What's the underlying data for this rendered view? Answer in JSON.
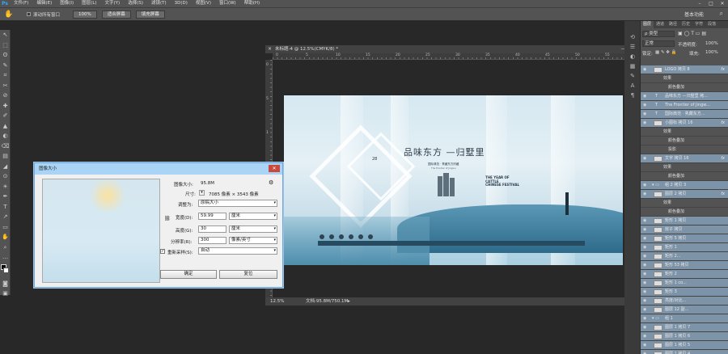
{
  "app": {
    "logo": "Ps"
  },
  "menu": [
    "文件(F)",
    "编辑(E)",
    "图像(I)",
    "图层(L)",
    "文字(Y)",
    "选择(S)",
    "滤镜(T)",
    "3D(D)",
    "视图(V)",
    "窗口(W)",
    "帮助(H)"
  ],
  "window_controls": {
    "min": "–",
    "max": "□",
    "close": "✕"
  },
  "options": {
    "scroll_all_label": "滚动所有窗口",
    "zoom_100": "100%",
    "fit_screen": "适合屏幕",
    "fill_screen": "填充屏幕",
    "workspace": "基本功能"
  },
  "document": {
    "tab_title": "未标题-4 @ 12.5%(CMYK/8) *",
    "zoom": "12.5%",
    "doc_size": "文档:95.8M/750.1M",
    "ruler_h": [
      "0",
      "5",
      "10",
      "15",
      "20",
      "25",
      "30",
      "35",
      "40",
      "45",
      "50",
      "55",
      "60"
    ],
    "ruler_v": [
      "0",
      "5",
      "1",
      "1",
      "2",
      "2",
      "3"
    ]
  },
  "artwork": {
    "headline": "品味东方  —归墅里",
    "subline": "国际典范 · 隽藏东方府藏",
    "subline2": "The Frontier of Jingwu",
    "badge": "28",
    "year_text": [
      "THE YEAR OF",
      "CATTLE",
      "CHINESE FESTIVAL"
    ]
  },
  "dialog": {
    "title": "图像大小",
    "close": "✕",
    "image_size_label": "图像大小:",
    "image_size_value": "95.8M",
    "dims_label": "尺寸:",
    "dims_value": "7085 像素 × 3543 像素",
    "fit_label": "调整为:",
    "fit_value": "原稿大小",
    "width_label": "宽度(D):",
    "width_value": "59.99",
    "width_unit": "厘米",
    "height_label": "高度(G):",
    "height_value": "30",
    "height_unit": "厘米",
    "res_label": "分辨率(R):",
    "res_value": "300",
    "res_unit": "像素/英寸",
    "resample_label": "重新采样(S):",
    "resample_value": "自动",
    "resample_checked": "✓",
    "ok": "确定",
    "reset": "复位"
  },
  "panel": {
    "tabs": [
      "图层",
      "通道",
      "路径",
      "历史",
      "字符",
      "段落"
    ],
    "kind_filter": "ρ 类型",
    "blend_mode": "正常",
    "opacity_label": "不透明度:",
    "opacity_value": "100%",
    "lock_label": "锁定:",
    "fill_label": "填充:",
    "fill_value": "100%",
    "layers": [
      {
        "name": "LOGO 拷贝 8",
        "fx": "fx",
        "sel": true
      },
      {
        "name": "效果",
        "fx": "",
        "sel": false,
        "sub": 1
      },
      {
        "name": "颜色叠加",
        "fx": "",
        "sel": false,
        "sub": 2
      },
      {
        "name": "品味东方 —归墅里 拷...",
        "fx": "",
        "sel": true,
        "type": "T"
      },
      {
        "name": "The Frontier of Jingw...",
        "fx": "",
        "sel": true,
        "type": "T"
      },
      {
        "name": "国际典范 · 隽藏东方...",
        "fx": "",
        "sel": true,
        "type": "T"
      },
      {
        "name": "小图标 拷贝 16",
        "fx": "fx",
        "sel": true
      },
      {
        "name": "效果",
        "fx": "",
        "sel": false,
        "sub": 1
      },
      {
        "name": "颜色叠加",
        "fx": "",
        "sel": false,
        "sub": 2
      },
      {
        "name": "投影",
        "fx": "",
        "sel": false,
        "sub": 2
      },
      {
        "name": "文字 拷贝 16",
        "fx": "fx",
        "sel": true
      },
      {
        "name": "效果",
        "fx": "",
        "sel": false,
        "sub": 1
      },
      {
        "name": "颜色叠加",
        "fx": "",
        "sel": false,
        "sub": 2
      },
      {
        "name": "组 2 拷贝 3",
        "fx": "",
        "sel": true,
        "group": true
      },
      {
        "name": "图层 2 拷贝",
        "fx": "fx",
        "sel": true
      },
      {
        "name": "效果",
        "fx": "",
        "sel": false,
        "sub": 1
      },
      {
        "name": "颜色叠加",
        "fx": "",
        "sel": false,
        "sub": 2
      },
      {
        "name": "矩形 1 拷贝",
        "fx": "",
        "sel": true
      },
      {
        "name": "房子 拷贝",
        "fx": "",
        "sel": true
      },
      {
        "name": "矩形 5 拷贝",
        "fx": "",
        "sel": true
      },
      {
        "name": "矩形 1",
        "fx": "",
        "sel": true
      },
      {
        "name": "矩形 2...",
        "fx": "",
        "sel": true
      },
      {
        "name": "矩形 53 拷贝",
        "fx": "",
        "sel": true
      },
      {
        "name": "矩形 2",
        "fx": "",
        "sel": true
      },
      {
        "name": "矩形 1 co...",
        "fx": "",
        "sel": true
      },
      {
        "name": "矩形 3",
        "fx": "",
        "sel": true
      },
      {
        "name": "亮度/对比...",
        "fx": "",
        "sel": true
      },
      {
        "name": "图层 12 副...",
        "fx": "",
        "sel": true
      },
      {
        "name": "组 1",
        "fx": "",
        "sel": true,
        "group": true
      },
      {
        "name": "图层 1 拷贝 7",
        "fx": "",
        "sel": true
      },
      {
        "name": "图层 1 拷贝 6",
        "fx": "",
        "sel": true
      },
      {
        "name": "图层 1 拷贝 5",
        "fx": "",
        "sel": true
      },
      {
        "name": "图层 1 拷贝 4",
        "fx": "",
        "sel": true
      }
    ]
  },
  "tools": [
    "↖",
    "⬚",
    "ʘ",
    "✎",
    "⌗",
    "✂",
    "⊘",
    "✚",
    "✐",
    "▲",
    "◐",
    "⌫",
    "▤",
    "◢",
    "⊙",
    "☀",
    "✒",
    "T",
    "↗",
    "▭",
    "✋",
    "⌕",
    "…"
  ]
}
